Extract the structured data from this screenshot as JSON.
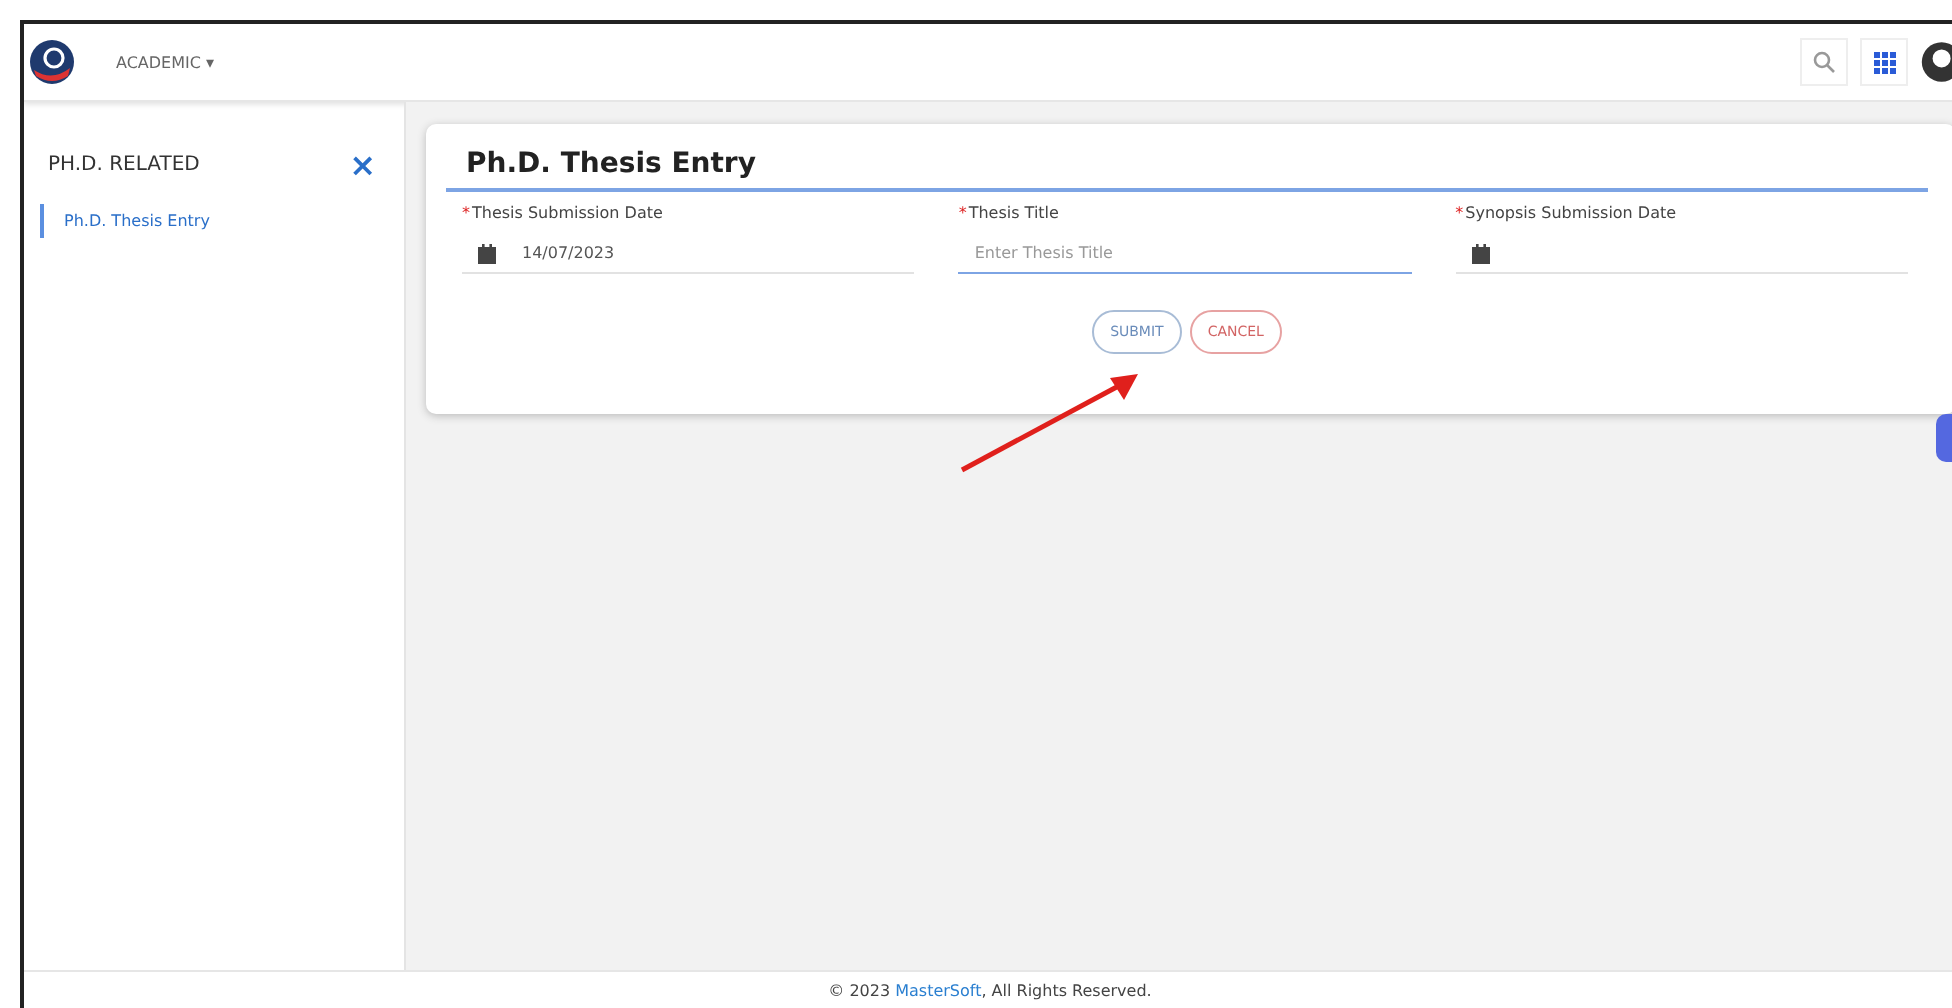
{
  "topbar": {
    "module_menu": "ACADEMIC ▾"
  },
  "sidebar": {
    "title": "PH.D. RELATED",
    "close": "×",
    "items": [
      {
        "label": "Ph.D. Thesis Entry",
        "selected": true
      }
    ]
  },
  "card": {
    "title": "Ph.D. Thesis Entry",
    "fields": [
      {
        "kind": "date",
        "label": "Thesis Submission Date",
        "required": "*",
        "value": "14/07/2023",
        "focused": false
      },
      {
        "kind": "text",
        "label": "Thesis Title",
        "required": "*",
        "placeholder": "Enter Thesis Title",
        "focused": true
      },
      {
        "kind": "date",
        "label": "Synopsis Submission Date",
        "required": "*",
        "focused": false
      }
    ],
    "buttons": [
      {
        "kind": "submit",
        "label": "SUBMIT"
      },
      {
        "kind": "cancel",
        "label": "CANCEL"
      }
    ]
  },
  "footer": {
    "prefix": "© 2023 ",
    "brand": "MasterSoft",
    "suffix": ", All Rights Reserved."
  }
}
